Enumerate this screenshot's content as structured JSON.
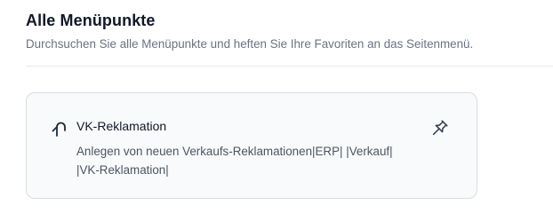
{
  "header": {
    "title": "Alle Menüpunkte",
    "subtitle": "Durchsuchen Sie alle Menüpunkte und heften Sie Ihre Favoriten an das Seitenmenü."
  },
  "menu_items": [
    {
      "icon": "return-arrow-icon",
      "title": "VK-Reklamation",
      "description": "Anlegen von neuen Verkaufs-Reklamationen|ERP| |Verkauf| |VK-Reklamation|",
      "pin_icon": "pin-icon",
      "pinned": false
    }
  ]
}
